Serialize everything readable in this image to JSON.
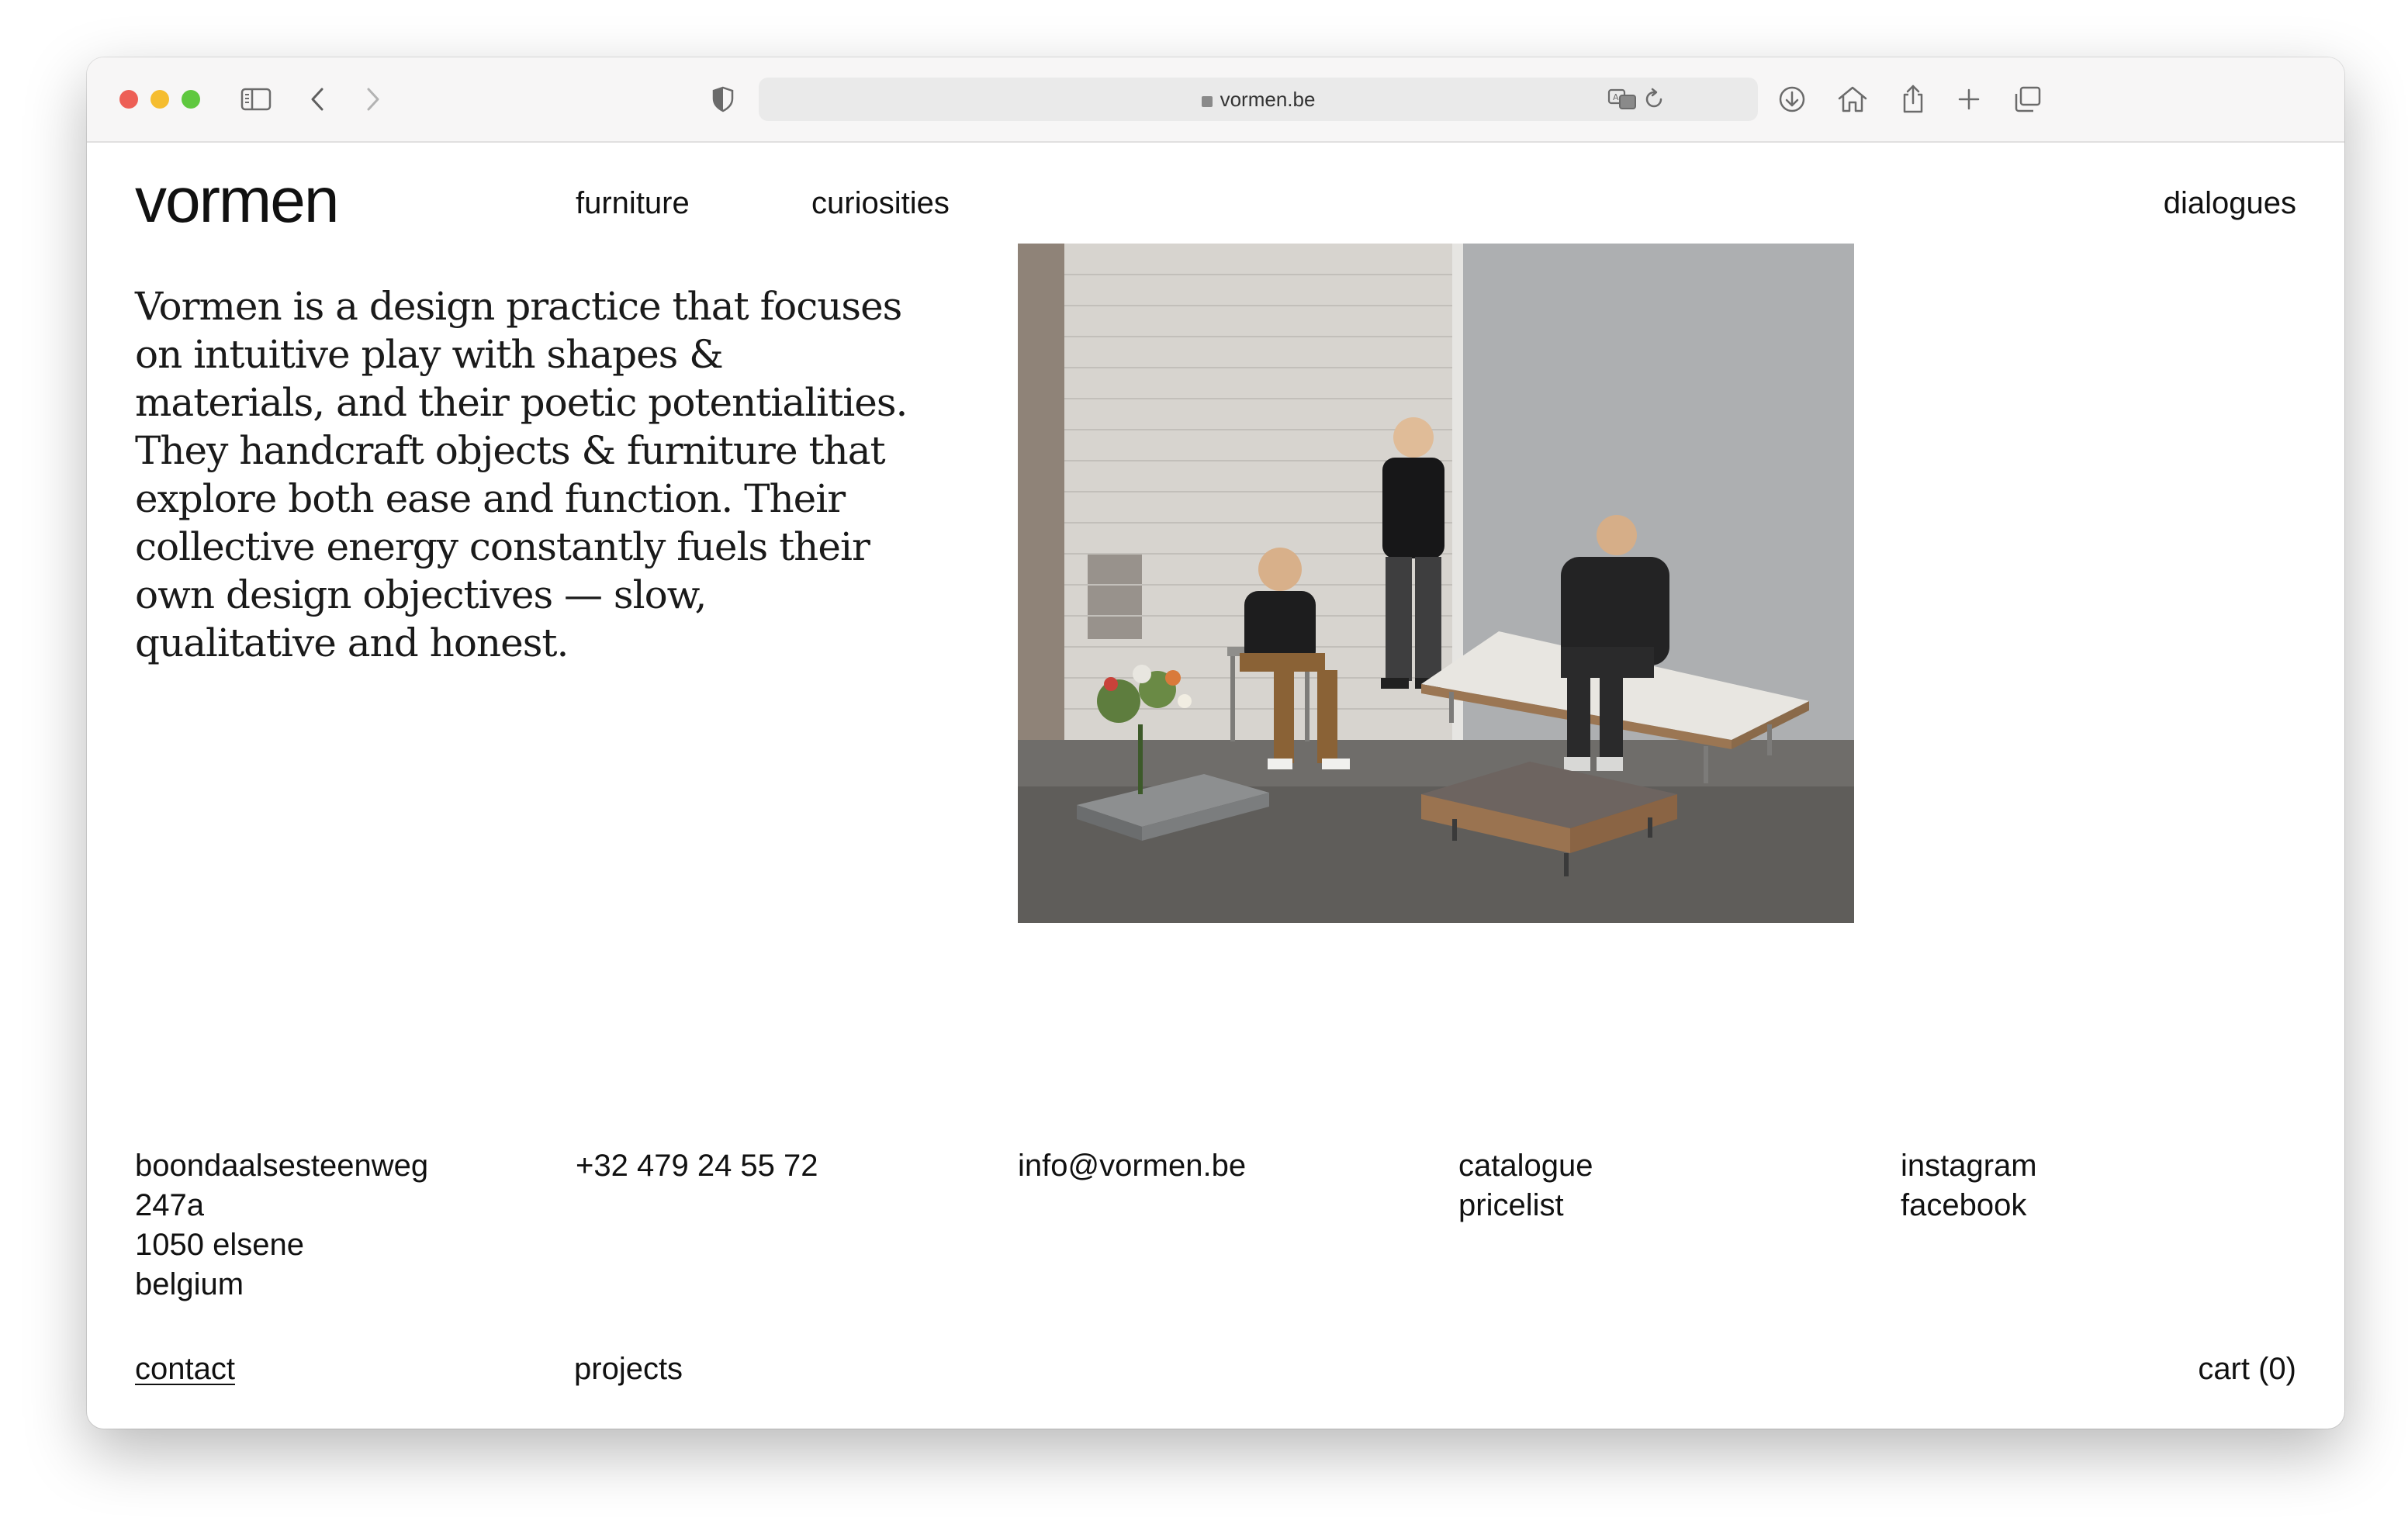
{
  "browser": {
    "url": "vormen.be"
  },
  "site": {
    "logo": "vormen",
    "nav": {
      "furniture": "furniture",
      "curiosities": "curiosities",
      "dialogues": "dialogues"
    },
    "intro": "Vormen is a design practice that focuses on intuitive play with shapes & materials, and their poetic potentialities. They handcraft objects & furniture that explore both ease and function. Their collective energy constantly fuels their own design objectives — slow, qualitative and honest."
  },
  "footer": {
    "address": [
      "boondaalsesteenweg",
      "247a",
      "1050 elsene",
      "belgium"
    ],
    "phone": "+32 479 24 55 72",
    "email": "info@vormen.be",
    "docs": [
      "catalogue",
      "pricelist"
    ],
    "social": [
      "instagram",
      "facebook"
    ],
    "contact": "contact",
    "projects": "projects",
    "cart": "cart (0)"
  }
}
